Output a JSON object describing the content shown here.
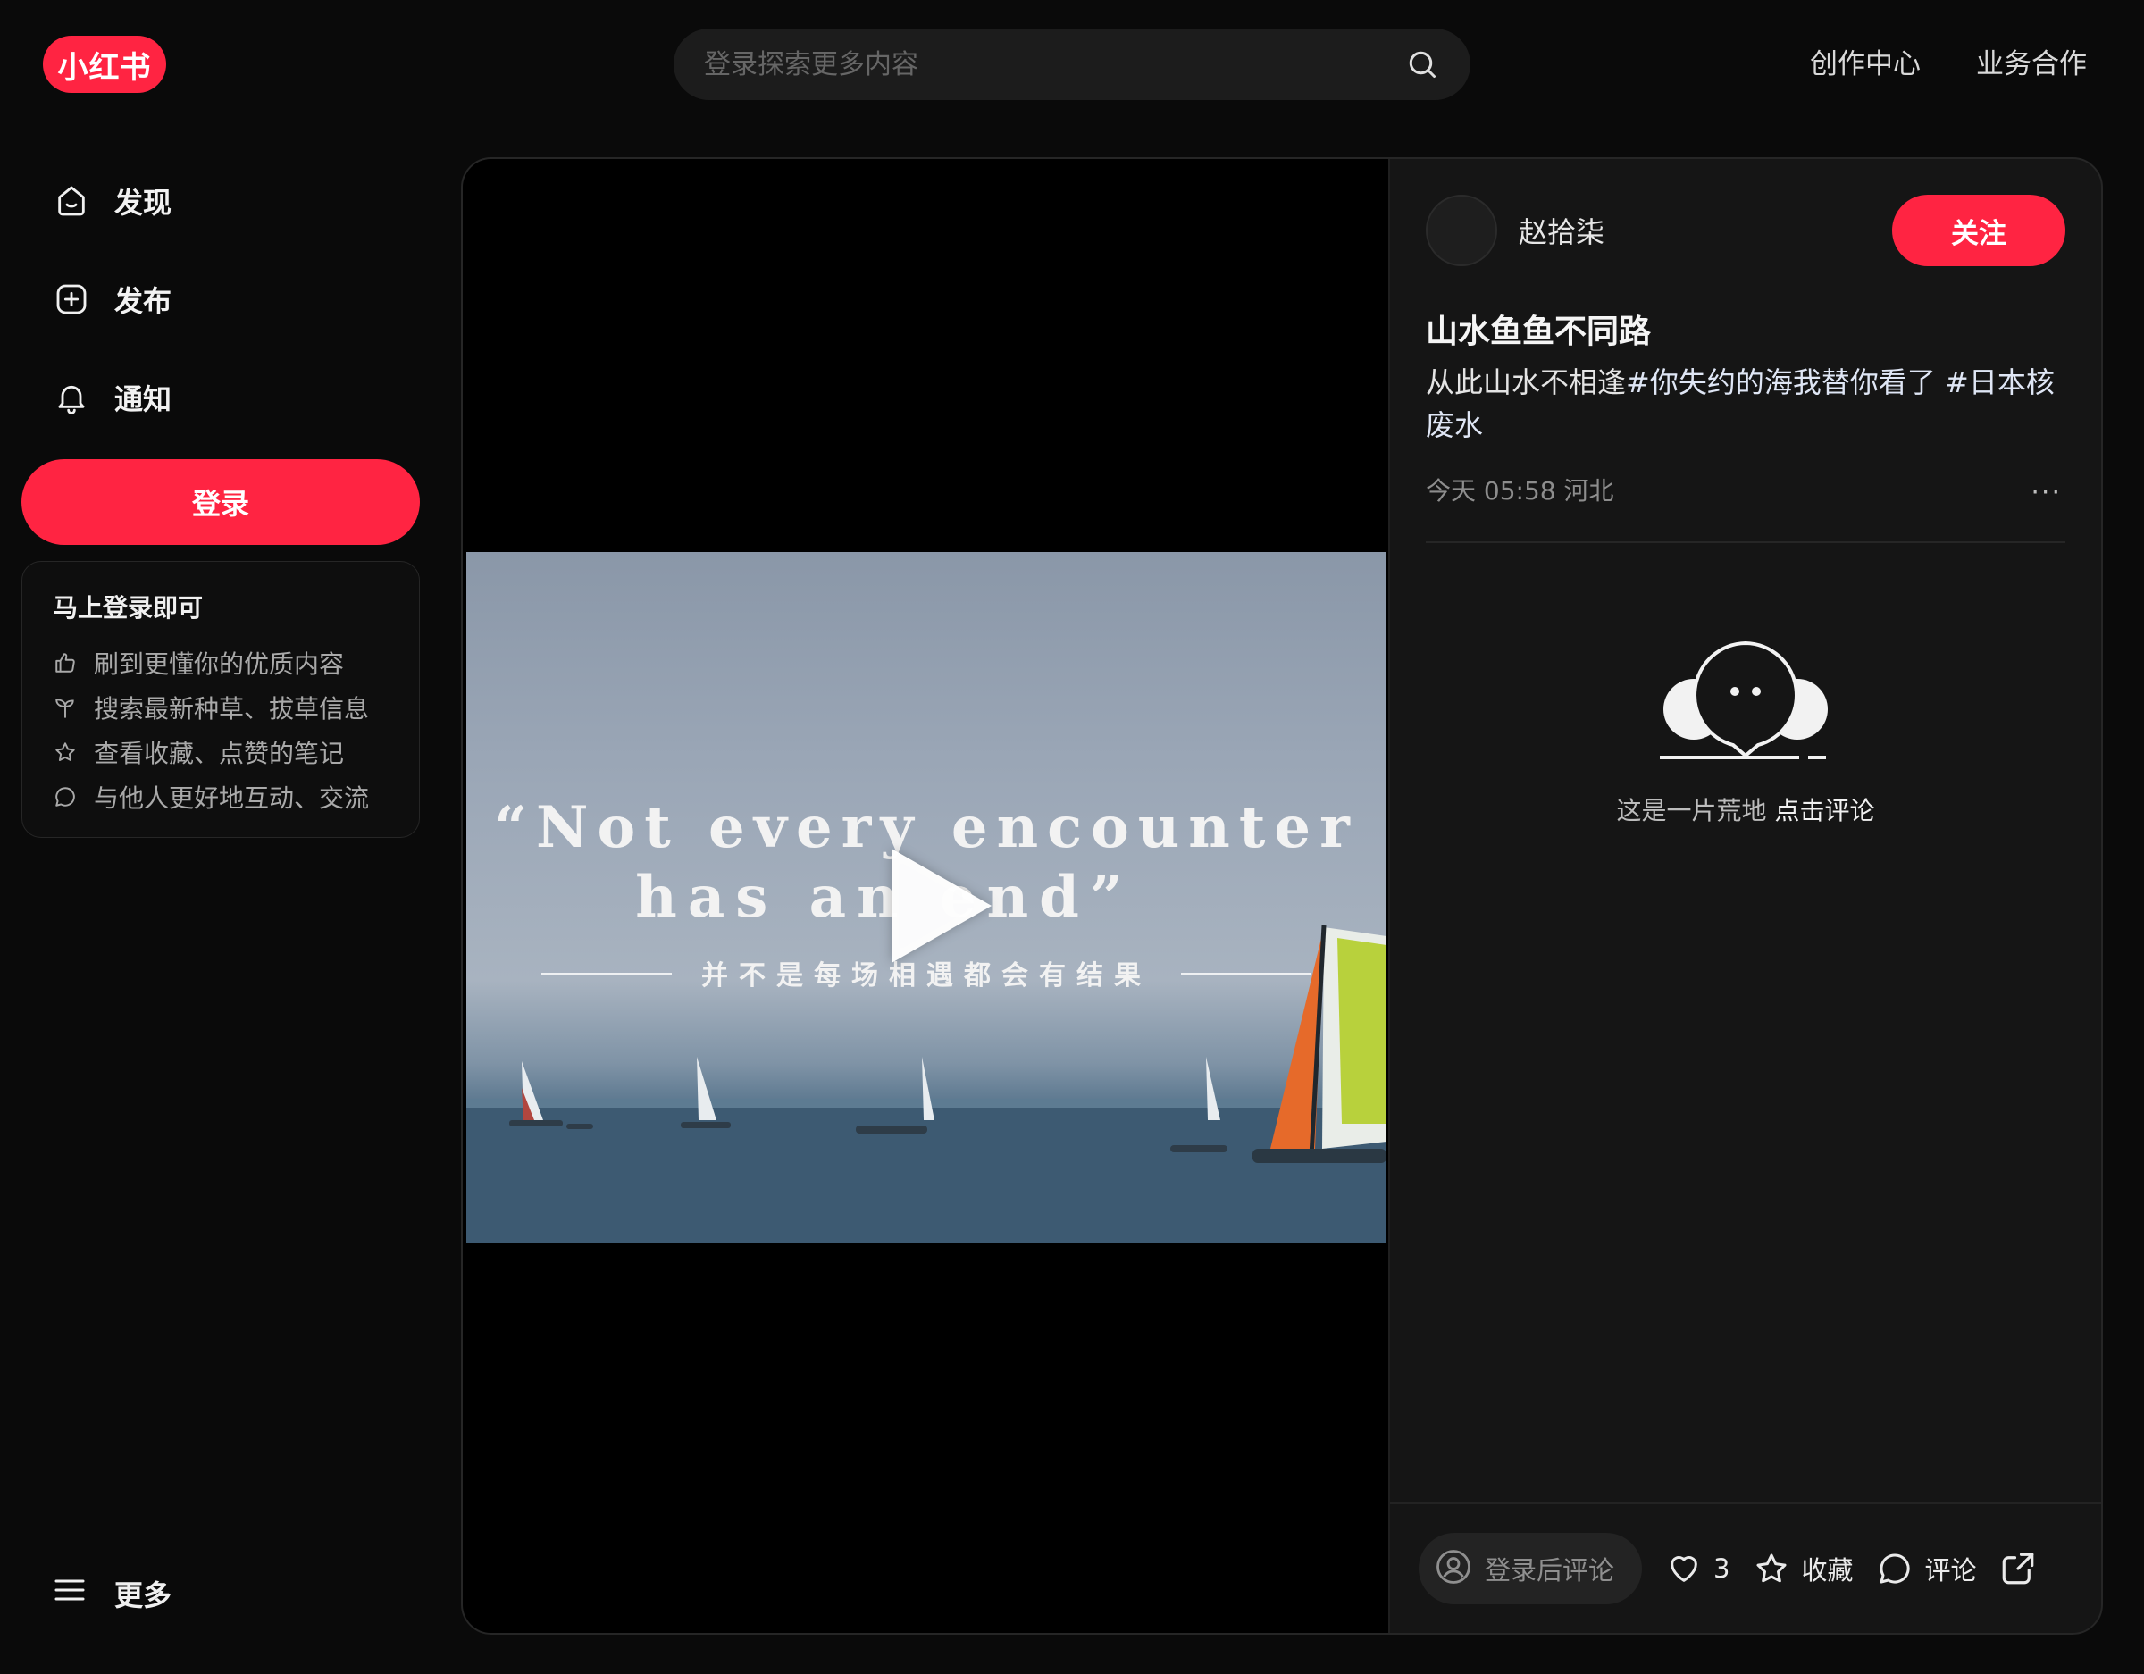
{
  "header": {
    "logo": "小红书",
    "search_placeholder": "登录探索更多内容",
    "links": [
      "创作中心",
      "业务合作"
    ]
  },
  "sidebar": {
    "nav": [
      {
        "label": "发现",
        "icon": "home-icon"
      },
      {
        "label": "发布",
        "icon": "plus-square-icon"
      },
      {
        "label": "通知",
        "icon": "bell-icon"
      }
    ],
    "login_button": "登录",
    "login_card": {
      "title": "马上登录即可",
      "perks": [
        {
          "icon": "thumbs-up-icon",
          "text": "刷到更懂你的优质内容"
        },
        {
          "icon": "sprout-icon",
          "text": "搜索最新种草、拔草信息"
        },
        {
          "icon": "star-icon",
          "text": "查看收藏、点赞的笔记"
        },
        {
          "icon": "chat-icon",
          "text": "与他人更好地互动、交流"
        }
      ]
    },
    "more_label": "更多"
  },
  "note": {
    "video": {
      "line1": "“Not every encounter",
      "line2": "has an end”",
      "subtitle": "并不是每场相遇都会有结果"
    },
    "author_name": "赵拾柒",
    "follow_label": "关注",
    "title": "山水鱼鱼不同路",
    "desc_text": "从此山水不相逢",
    "desc_tags": [
      "#你失约的海我替你看了",
      "#日本核废水"
    ],
    "meta": "今天 05:58 河北",
    "more_label": "···",
    "empty_text": "这是一片荒地",
    "empty_link": "点击评论",
    "actions": {
      "comment_placeholder": "登录后评论",
      "like_count": "3",
      "collect_label": "收藏",
      "comment_label": "评论"
    }
  },
  "colors": {
    "brand": "#ff2442",
    "background": "#0a0a0a",
    "panel": "#151515"
  }
}
